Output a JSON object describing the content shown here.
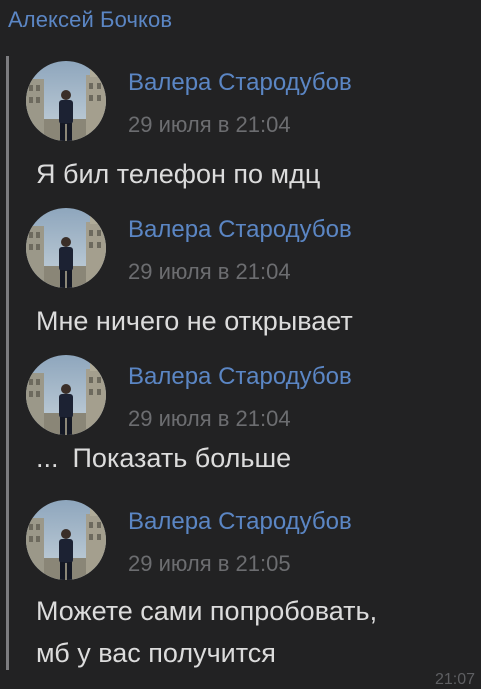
{
  "sender": {
    "name": "Алексей Бочков"
  },
  "forwarded": [
    {
      "author": "Валера Стародубов",
      "time": "29 июля в 21:04",
      "text": [
        "Я бил телефон по мдц"
      ]
    },
    {
      "author": "Валера Стародубов",
      "time": "29 июля в 21:04",
      "text": [
        "Мне ничего не открывает"
      ]
    },
    {
      "author": "Валера Стародубов",
      "time": "29 июля в 21:04",
      "text": []
    },
    {
      "author": "Валера Стародубов",
      "time": "29 июля в 21:05",
      "text": [
        "Можете сами попробовать,",
        "мб у вас получится"
      ]
    }
  ],
  "show_more": {
    "dots": "...",
    "label": "Показать больше"
  },
  "message_time": "21:07",
  "colors": {
    "background": "#222223",
    "link_blue": "#5b86c4",
    "timestamp_gray": "#6c6d70",
    "text": "#dcdcdc",
    "quote_bar": "#7d7d80"
  }
}
